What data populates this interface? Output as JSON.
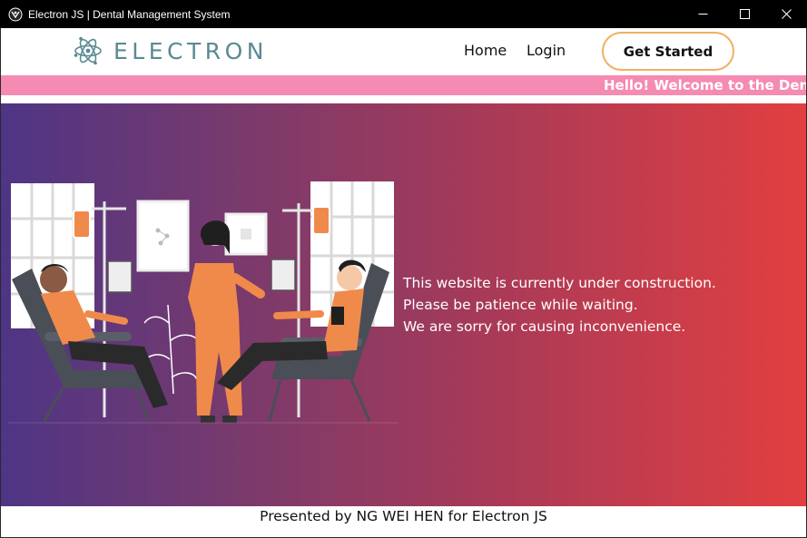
{
  "window": {
    "title": "Electron JS | Dental Management System",
    "controls": [
      "minimize-icon",
      "maximize-icon",
      "close-icon"
    ]
  },
  "nav": {
    "brand": "ELECTRON",
    "links": [
      "Home",
      "Login"
    ],
    "cta": "Get Started"
  },
  "marquee": {
    "text": "Hello! Welcome to the Dento"
  },
  "hero": {
    "lines": [
      "This website is currently under construction.",
      "Please be patience while waiting.",
      "We are sorry for causing inconvenience."
    ]
  },
  "footer": {
    "text": "Presented by NG WEI HEN for Electron JS"
  },
  "colors": {
    "marquee_bg": "#f58ab3",
    "cta_border": "#f0b062",
    "brand_text": "#5a8a93",
    "hero_gradient_start": "#4e3585",
    "hero_gradient_end": "#e23f40"
  }
}
